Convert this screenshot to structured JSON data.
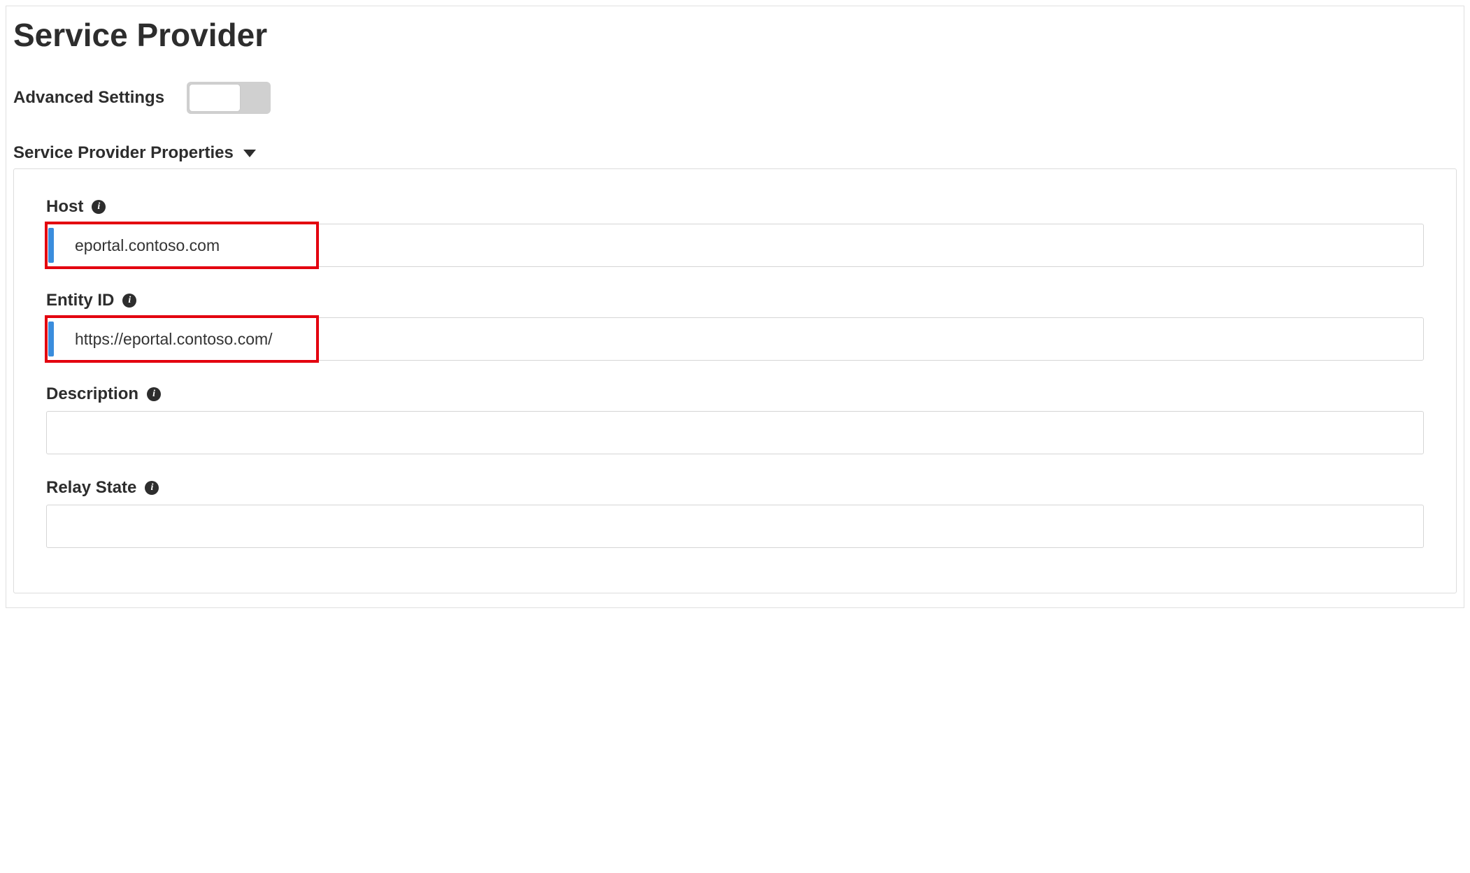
{
  "page": {
    "title": "Service Provider"
  },
  "advanced": {
    "label": "Advanced Settings",
    "enabled": false
  },
  "section": {
    "title": "Service Provider Properties"
  },
  "fields": {
    "host": {
      "label": "Host",
      "value": "eportal.contoso.com",
      "highlighted": true,
      "accent": true
    },
    "entity_id": {
      "label": "Entity ID",
      "value": "https://eportal.contoso.com/",
      "highlighted": true,
      "accent": true
    },
    "description": {
      "label": "Description",
      "value": "",
      "highlighted": false,
      "accent": false
    },
    "relay_state": {
      "label": "Relay State",
      "value": "",
      "highlighted": false,
      "accent": false
    }
  },
  "icons": {
    "info_glyph": "i"
  }
}
